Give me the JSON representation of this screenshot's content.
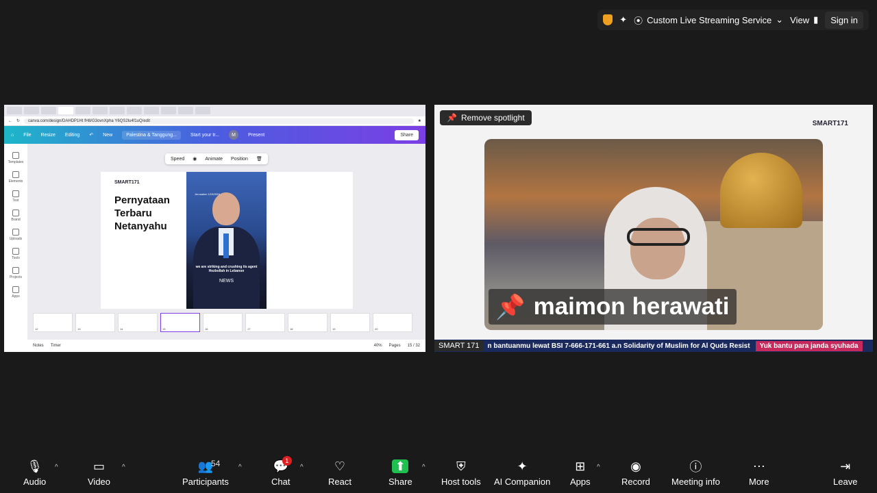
{
  "topbar": {
    "streaming_label": "Custom Live Streaming Service",
    "view_label": "View",
    "signin_label": "Sign in"
  },
  "canva": {
    "url": "canva.com/design/DAHDP1Ht fH8/G3ovnXpha Y6QS2lu4f1uQ/edit",
    "menu": {
      "file": "File",
      "resize": "Resize",
      "editing": "Editing"
    },
    "new_badge": "New",
    "doc_title": "Palestina & Tanggung...",
    "start_label": "Start your tr...",
    "avatar_initial": "M",
    "present_label": "Present",
    "share_label": "Share",
    "sidebar": [
      "Templates",
      "Elements",
      "Text",
      "Brand",
      "Uploads",
      "Tools",
      "Projects",
      "Apps"
    ],
    "toolbar": {
      "speed": "Speed",
      "animate": "Animate",
      "position": "Position"
    },
    "slide": {
      "logo": "SMART171",
      "heading": "Pernyataan Terbaru Netanyahu",
      "photo_date": "Jerusalem 12/3/2024",
      "photo_caption": "we are striking and crushing its agent Hezbollah in Lebanon",
      "photo_news": "NEWS"
    },
    "thumb_numbers": [
      "12",
      "13",
      "14",
      "15",
      "16",
      "17",
      "18",
      "19",
      "20"
    ],
    "status": {
      "notes": "Notes",
      "timer": "Timer",
      "zoom": "40%",
      "pages": "Pages",
      "page_count": "15 / 32"
    }
  },
  "spotlight": {
    "remove_label": "Remove spotlight",
    "logo": "SMART171",
    "participant_name": "maimon herawati",
    "source_label": "SMART 171",
    "ticker_text": "n bantuanmu lewat BSI 7-666-171-661 a.n Solidarity of Muslim for Al Quds Resist",
    "ticker_highlight": "Yuk bantu para janda syuhada"
  },
  "bottombar": {
    "audio": "Audio",
    "video": "Video",
    "participants": "Participants",
    "participant_count": "54",
    "chat": "Chat",
    "chat_badge": "1",
    "react": "React",
    "share": "Share",
    "host_tools": "Host tools",
    "ai_companion": "AI Companion",
    "apps": "Apps",
    "record": "Record",
    "meeting_info": "Meeting info",
    "more": "More",
    "leave": "Leave"
  }
}
